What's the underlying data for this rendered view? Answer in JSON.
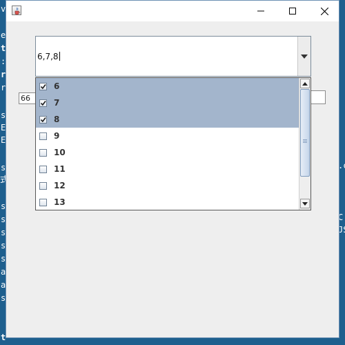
{
  "background_text": [
    "v",
    "e",
    "t",
    ":",
    "r",
    "r",
    "s",
    "E",
    "E",
    "s",
    "式",
    "s",
    "s",
    "s",
    "s",
    "s",
    "a",
    "a",
    "s",
    "t",
    ".c",
    "C",
    "JS"
  ],
  "window": {
    "title": "",
    "icon": "java-cup-icon",
    "controls": [
      "minimize-icon",
      "maximize-icon",
      "close-icon"
    ]
  },
  "combo": {
    "value": "6,7,8",
    "arrow_icon": "chevron-down-icon"
  },
  "fields": {
    "left_value": "66",
    "right_value": ""
  },
  "list": {
    "items": [
      {
        "label": "6",
        "checked": true,
        "selected": true
      },
      {
        "label": "7",
        "checked": true,
        "selected": true
      },
      {
        "label": "8",
        "checked": true,
        "selected": true
      },
      {
        "label": "9",
        "checked": false,
        "selected": false
      },
      {
        "label": "10",
        "checked": false,
        "selected": false
      },
      {
        "label": "11",
        "checked": false,
        "selected": false
      },
      {
        "label": "12",
        "checked": false,
        "selected": false
      },
      {
        "label": "13",
        "checked": false,
        "selected": false
      }
    ],
    "scroll_position": 0
  },
  "colors": {
    "selection": "#a3b5cc",
    "window_bg": "#eeeeee",
    "desktop_bg": "#1e5f8e"
  }
}
